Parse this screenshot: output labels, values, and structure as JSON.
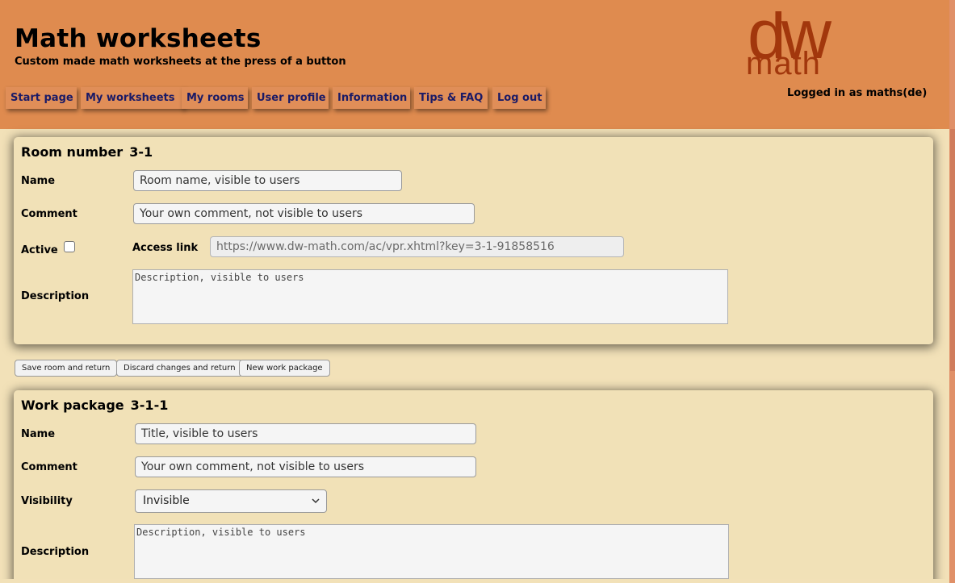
{
  "header": {
    "title": "Math worksheets",
    "subtitle": "Custom made math worksheets at the press of a button",
    "logo": {
      "line1": "dw",
      "line2": "math"
    },
    "logged_in": "Logged in as maths(de)"
  },
  "nav": [
    "Start page",
    "My worksheets",
    "My rooms",
    "User profile",
    "Information",
    "Tips & FAQ",
    "Log out"
  ],
  "room": {
    "heading": "Room number",
    "number": "3-1",
    "name_label": "Name",
    "name_placeholder": "Room name, visible to users",
    "comment_label": "Comment",
    "comment_placeholder": "Your own comment, not visible to users",
    "active_label": "Active",
    "active_checked": false,
    "access_label": "Access link",
    "access_value": "https://www.dw-math.com/ac/vpr.xhtml?key=3-1-91858516",
    "description_label": "Description",
    "description_placeholder": "Description, visible to users"
  },
  "buttons": {
    "save": "Save room and return",
    "discard": "Discard changes and return",
    "new_package": "New work package"
  },
  "package": {
    "heading": "Work package",
    "number": "3-1-1",
    "name_label": "Name",
    "name_placeholder": "Title, visible to users",
    "comment_label": "Comment",
    "comment_placeholder": "Your own comment, not visible to users",
    "visibility_label": "Visibility",
    "visibility_value": "Invisible",
    "description_label": "Description",
    "description_placeholder": "Description, visible to users"
  },
  "icons": {
    "select": "chevron-down-icon",
    "checkbox": "checkbox-icon"
  },
  "colors": {
    "header_bg": "#df8b4f",
    "page_bg": "#f2e1b8",
    "nav_text": "#1a1a66",
    "logo": "#b8400c"
  }
}
